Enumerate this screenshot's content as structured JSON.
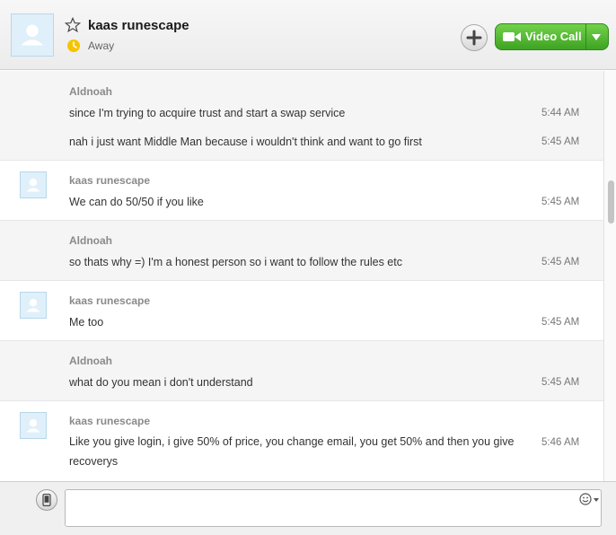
{
  "header": {
    "contact_name": "kaas runescape",
    "status": "Away",
    "video_call_label": "Video Call"
  },
  "messages": [
    {
      "sender": "Aldnoah",
      "lines": [
        {
          "text": "since I'm trying to acquire trust and start a swap service",
          "time": "5:44 AM"
        },
        {
          "text": "nah i just want Middle Man because i wouldn't think and want to go first",
          "time": "5:45 AM"
        }
      ]
    },
    {
      "sender": "kaas runescape",
      "lines": [
        {
          "text": "We can do 50/50 if you like",
          "time": "5:45 AM"
        }
      ]
    },
    {
      "sender": "Aldnoah",
      "lines": [
        {
          "text": "so thats why =) I'm a honest person so i want to follow the rules etc",
          "time": "5:45 AM"
        }
      ]
    },
    {
      "sender": "kaas runescape",
      "lines": [
        {
          "text": "Me too",
          "time": "5:45 AM"
        }
      ]
    },
    {
      "sender": "Aldnoah",
      "lines": [
        {
          "text": "what do you mean i don't understand",
          "time": "5:45 AM"
        }
      ]
    },
    {
      "sender": "kaas runescape",
      "lines": [
        {
          "text": "Like you give login, i give 50% of price, you change email, you get 50% and then you give recoverys",
          "time": "5:46 AM"
        }
      ]
    }
  ],
  "composer": {
    "value": ""
  },
  "icons": {
    "contact_avatar": "person-icon",
    "favorite": "star-outline-icon",
    "status": "away-clock-icon",
    "add": "plus-icon",
    "video": "video-camera-icon",
    "dropdown": "chevron-down-icon",
    "phone": "mobile-phone-icon",
    "emoticons": "smiley-icon"
  },
  "colors": {
    "video_green": "#4cb52c",
    "away_yellow": "#f5c400",
    "sender_gray": "#8a8a8a"
  }
}
